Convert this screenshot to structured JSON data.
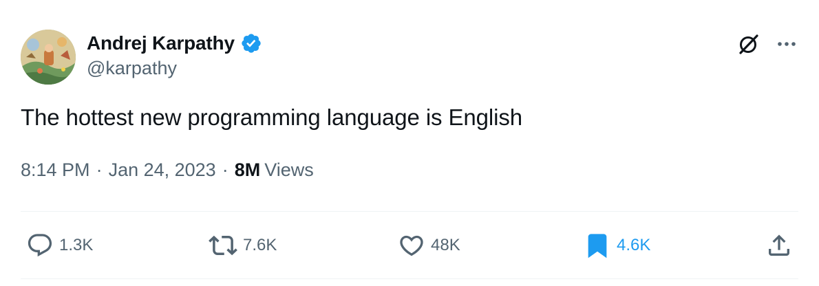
{
  "author": {
    "display_name": "Andrej Karpathy",
    "handle": "@karpathy",
    "verified": true,
    "verified_color": "#1d9bf0"
  },
  "tweet": {
    "text": "The hottest new programming language is English",
    "time": "8:14 PM",
    "separator": "·",
    "date": "Jan 24, 2023",
    "views_count": "8M",
    "views_label": "Views"
  },
  "actions": {
    "replies": "1.3K",
    "retweets": "7.6K",
    "likes": "48K",
    "bookmarks": "4.6K",
    "bookmark_active": true,
    "accent_color": "#1d9bf0"
  },
  "icons": {
    "grok": "grok-icon",
    "more": "more-icon",
    "reply": "reply-icon",
    "retweet": "retweet-icon",
    "like": "heart-icon",
    "bookmark": "bookmark-icon",
    "share": "share-icon"
  },
  "colors": {
    "text_primary": "#0f1419",
    "text_secondary": "#536471",
    "divider": "#eff3f4"
  }
}
